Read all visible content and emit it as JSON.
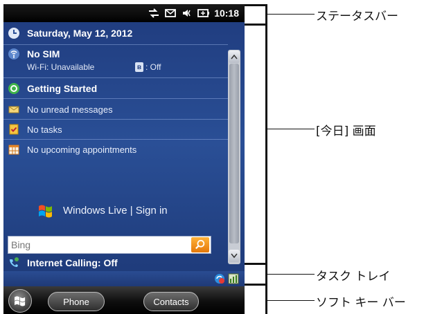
{
  "status_bar": {
    "time": "10:18",
    "icons": [
      "connectivity-icon",
      "mail-icon",
      "volume-icon",
      "battery-icon"
    ]
  },
  "today": {
    "date": "Saturday, May 12, 2012",
    "sim": "No SIM",
    "wifi": "Wi-Fi: Unavailable",
    "bluetooth": ": Off",
    "getting_started": "Getting Started",
    "messages": "No unread messages",
    "tasks": "No tasks",
    "appointments": "No upcoming appointments",
    "windows_live": "Windows Live | Sign in",
    "search_placeholder": "Bing",
    "internet_calling": "Internet Calling: Off"
  },
  "soft_keys": {
    "left": "Phone",
    "right": "Contacts"
  },
  "callouts": {
    "status_bar": "ステータスバー",
    "today_screen": "[今日] 画面",
    "task_tray": "タスク トレイ",
    "soft_key_bar": "ソフト キー バー"
  },
  "colors": {
    "today_bg": "#2a4f96",
    "search_button": "#f39a1f"
  }
}
